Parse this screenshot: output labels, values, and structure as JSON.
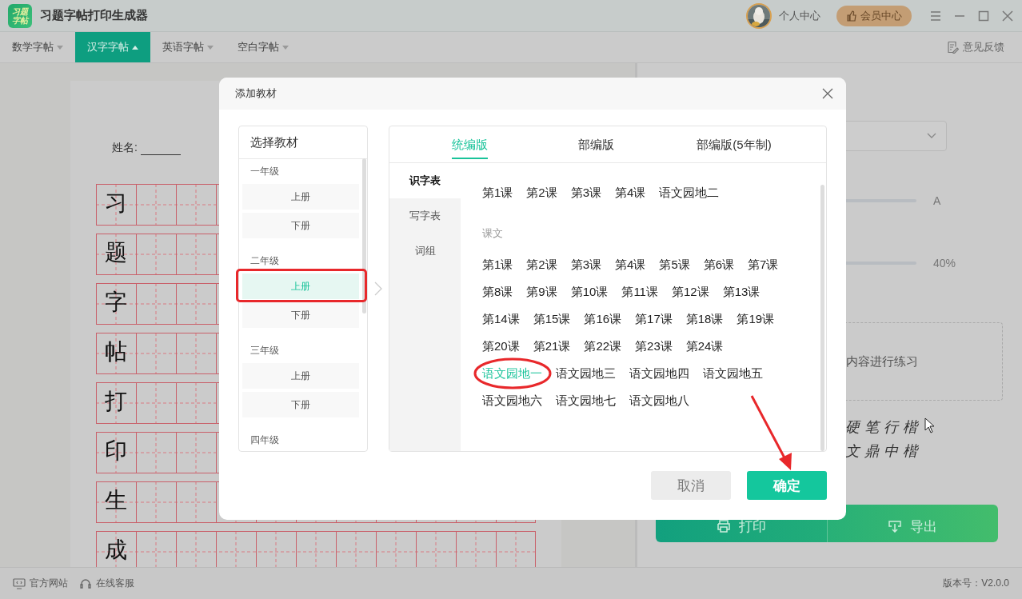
{
  "app": {
    "logo": [
      "习题",
      "字帖"
    ],
    "title": "习题字帖打印生成器",
    "user": "个人中心",
    "member_button": "会员中心"
  },
  "nav": {
    "tabs": [
      {
        "label": "数学字帖",
        "selected": false
      },
      {
        "label": "汉字字帖",
        "selected": true
      },
      {
        "label": "英语字帖",
        "selected": false
      },
      {
        "label": "空白字帖",
        "selected": false
      }
    ],
    "feedback": "意见反馈"
  },
  "worksheet": {
    "name_label": "姓名:",
    "characters": [
      "习",
      "题",
      "字",
      "帖",
      "打",
      "印",
      "生",
      "成"
    ]
  },
  "settings": {
    "sliders": [
      {
        "reading": "A"
      },
      {
        "reading": "40%"
      }
    ],
    "hint": "内容进行练习",
    "fonts": [
      "硬笔行楷",
      "文鼎中楷"
    ],
    "buttons": [
      "打印",
      "导出"
    ]
  },
  "dialog": {
    "title": "添加教材",
    "textbook_header": "选择教材",
    "grades": [
      {
        "name": "一年级",
        "volumes": [
          {
            "label": "上册",
            "selected": false
          },
          {
            "label": "下册",
            "selected": false
          }
        ]
      },
      {
        "name": "二年级",
        "volumes": [
          {
            "label": "上册",
            "selected": true
          },
          {
            "label": "下册",
            "selected": false
          }
        ]
      },
      {
        "name": "三年级",
        "volumes": [
          {
            "label": "上册",
            "selected": false
          },
          {
            "label": "下册",
            "selected": false
          }
        ]
      },
      {
        "name": "四年级"
      }
    ],
    "editions": [
      {
        "label": "统编版",
        "selected": true
      },
      {
        "label": "部编版",
        "selected": false
      },
      {
        "label": "部编版(5年制)",
        "selected": false
      }
    ],
    "lists": [
      {
        "label": "识字表",
        "selected": true
      },
      {
        "label": "写字表",
        "selected": false
      },
      {
        "label": "词组",
        "selected": false
      }
    ],
    "sections": [
      {
        "lessons": [
          {
            "label": "第1课",
            "selected": false
          },
          {
            "label": "第2课",
            "selected": false
          },
          {
            "label": "第3课",
            "selected": false
          },
          {
            "label": "第4课",
            "selected": false
          },
          {
            "label": "语文园地二",
            "selected": false
          }
        ]
      },
      {
        "heading": "课文",
        "lessons": [
          {
            "label": "第1课",
            "selected": false
          },
          {
            "label": "第2课",
            "selected": false
          },
          {
            "label": "第3课",
            "selected": false
          },
          {
            "label": "第4课",
            "selected": false
          },
          {
            "label": "第5课",
            "selected": false
          },
          {
            "label": "第6课",
            "selected": false
          },
          {
            "label": "第7课",
            "selected": false
          },
          {
            "label": "第8课",
            "selected": false
          },
          {
            "label": "第9课",
            "selected": false
          },
          {
            "label": "第10课",
            "selected": false
          },
          {
            "label": "第11课",
            "selected": false
          },
          {
            "label": "第12课",
            "selected": false
          },
          {
            "label": "第13课",
            "selected": false
          },
          {
            "label": "第14课",
            "selected": false
          },
          {
            "label": "第15课",
            "selected": false
          },
          {
            "label": "第16课",
            "selected": false
          },
          {
            "label": "第17课",
            "selected": false
          },
          {
            "label": "第18课",
            "selected": false
          },
          {
            "label": "第19课",
            "selected": false
          },
          {
            "label": "第20课",
            "selected": false
          },
          {
            "label": "第21课",
            "selected": false
          },
          {
            "label": "第22课",
            "selected": false
          },
          {
            "label": "第23课",
            "selected": false
          },
          {
            "label": "第24课",
            "selected": false
          },
          {
            "label": "语文园地一",
            "selected": true
          },
          {
            "label": "语文园地三",
            "selected": false
          },
          {
            "label": "语文园地四",
            "selected": false
          },
          {
            "label": "语文园地五",
            "selected": false
          },
          {
            "label": "语文园地六",
            "selected": false
          },
          {
            "label": "语文园地七",
            "selected": false
          },
          {
            "label": "语文园地八",
            "selected": false
          }
        ]
      }
    ],
    "cancel": "取消",
    "ok": "确定"
  },
  "status_bar": {
    "links": [
      "官方网站",
      "在线客服"
    ],
    "version": "版本号：V2.0.0"
  }
}
